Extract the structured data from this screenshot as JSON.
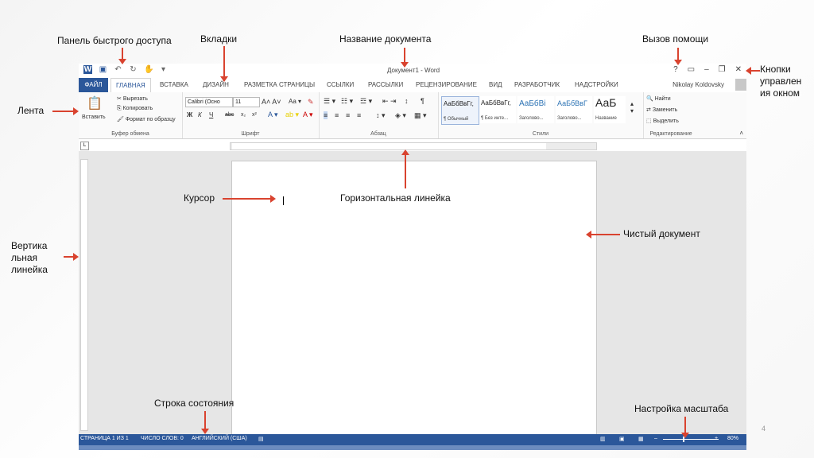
{
  "annotations": {
    "qat": "Панель быстрого доступа",
    "tabs": "Вкладки",
    "doc_name": "Название документа",
    "help": "Вызов помощи",
    "window_controls": "Кнопки управлен ия окном",
    "ribbon": "Лента",
    "cursor": "Курсор",
    "h_ruler": "Горизонтальная линейка",
    "blank_doc": "Чистый документ",
    "v_ruler": "Вертика льная линейка",
    "status_bar": "Строка состояния",
    "zoom": "Настройка масштаба"
  },
  "colors": {
    "arrow": "#d9432f",
    "word_blue": "#2b579a"
  },
  "word": {
    "title": "Документ1 - Word",
    "user": "Nikolay Koldovsky",
    "controls": {
      "help": "?",
      "display": "▭",
      "minimize": "–",
      "restore": "❐",
      "close": "✕"
    },
    "tabs": [
      "ФАЙЛ",
      "ГЛАВНАЯ",
      "ВСТАВКА",
      "ДИЗАЙН",
      "РАЗМЕТКА СТРАНИЦЫ",
      "ССЫЛКИ",
      "РАССЫЛКИ",
      "РЕЦЕНЗИРОВАНИЕ",
      "ВИД",
      "РАЗРАБОТЧИК",
      "НАДСТРОЙКИ"
    ],
    "ribbon": {
      "clipboard": {
        "paste": "Вставить",
        "cut": "Вырезать",
        "copy": "Копировать",
        "format": "Формат по образцу",
        "name": "Буфер обмена"
      },
      "font": {
        "family": "Calibri (Осно",
        "size": "11",
        "name": "Шрифт",
        "bold": "Ж",
        "italic": "К",
        "underline": "Ч",
        "strike": "abc",
        "sub": "x₂",
        "sup": "x²"
      },
      "paragraph": {
        "name": "Абзац"
      },
      "styles": {
        "name": "Стили",
        "items": [
          {
            "sample": "АаБбВвГг,",
            "label": "¶ Обычный"
          },
          {
            "sample": "АаБбВвГг,",
            "label": "¶ Без инте..."
          },
          {
            "sample": "АаБбВі",
            "label": "Заголово..."
          },
          {
            "sample": "АаБбВвГ",
            "label": "Заголово..."
          },
          {
            "sample": "АаБ",
            "label": "Название"
          }
        ]
      },
      "editing": {
        "find": "Найти",
        "replace": "Заменить",
        "select": "Выделить",
        "name": "Редактирование"
      }
    },
    "status": {
      "page": "СТРАНИЦА 1 ИЗ 1",
      "words": "ЧИСЛО СЛОВ: 0",
      "lang": "АНГЛИЙСКИЙ (США)",
      "zoom": "80%"
    }
  },
  "page_number": "4"
}
